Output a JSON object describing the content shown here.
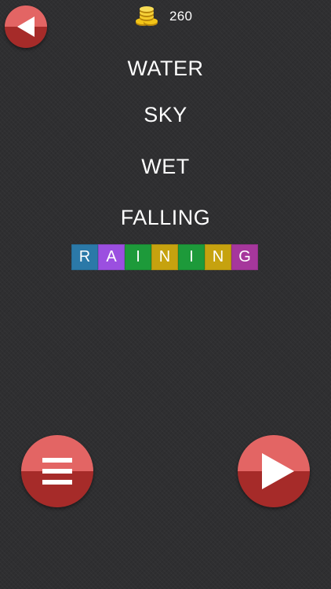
{
  "toolbar": {
    "coin_count": "260"
  },
  "clues": [
    "WATER",
    "SKY",
    "WET",
    "FALLING"
  ],
  "answer": {
    "letters": [
      "R",
      "A",
      "I",
      "N",
      "I",
      "N",
      "G"
    ],
    "tile_colors": [
      "#2b79a8",
      "#9b4fe0",
      "#1d9a3a",
      "#c6a20f",
      "#1d9a3a",
      "#c6a20f",
      "#a6379c"
    ]
  },
  "colors": {
    "button_top": "#e36564",
    "button_bottom": "#a62b29",
    "background": "#2f2f31",
    "coin": "#e8b917"
  },
  "icons": {
    "back": "triangle-left-icon",
    "menu": "hamburger-menu-icon",
    "play": "play-triangle-icon",
    "coins": "coin-stack-icon"
  }
}
